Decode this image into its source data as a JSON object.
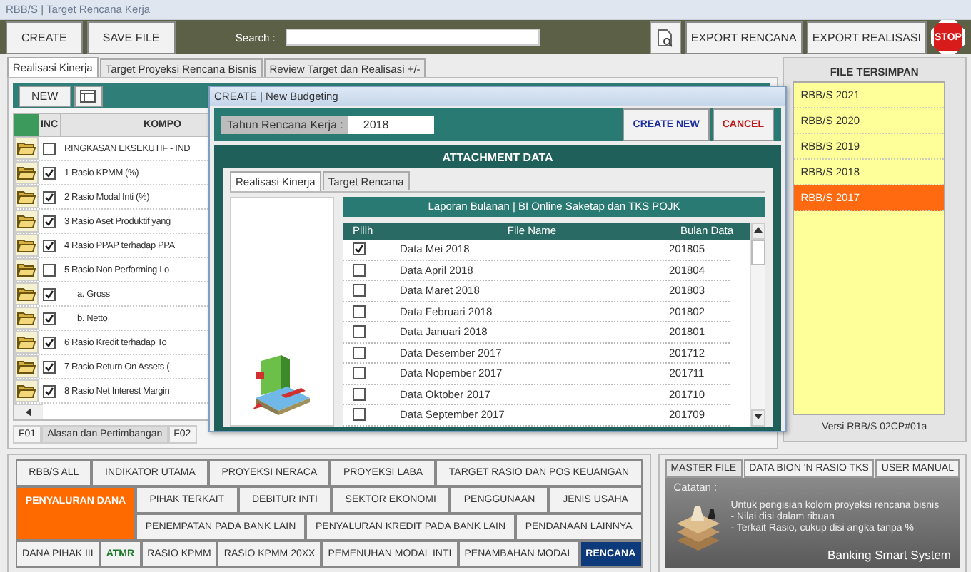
{
  "window": {
    "title": "RBB/S | Target Rencana Kerja"
  },
  "toolbar": {
    "buttons": [
      "CREATE",
      "SAVE FILE"
    ],
    "search_label": "Search :",
    "export_buttons": [
      "EXPORT RENCANA",
      "EXPORT REALISASI"
    ],
    "stop_label": "STOP"
  },
  "tabs": [
    {
      "label": "Realisasi Kinerja",
      "selected": true
    },
    {
      "label": "Target Proyeksi Rencana Bisnis",
      "selected": false
    },
    {
      "label": "Review Target dan Realisasi +/-",
      "selected": false
    }
  ],
  "panel": {
    "new_button": "NEW",
    "columns": [
      "INC",
      "KOMPO"
    ],
    "rows": [
      {
        "label": "RINGKASAN EKSEKUTIF - IND",
        "checked": false
      },
      {
        "label": "1 Rasio KPMM (%)",
        "checked": true
      },
      {
        "label": "2 Rasio Modal Inti (%)",
        "checked": true
      },
      {
        "label": "3 Rasio Aset Produktif yang",
        "checked": true
      },
      {
        "label": "4 Rasio PPAP terhadap PPA",
        "checked": true
      },
      {
        "label": "5 Rasio Non Performing Lo",
        "checked": false,
        "children": [
          {
            "label": "a. Gross",
            "checked": true
          },
          {
            "label": "b. Netto",
            "checked": true
          }
        ]
      },
      {
        "label": "6 Rasio Kredit terhadap To",
        "checked": true
      },
      {
        "label": "7 Rasio Return On Assets (",
        "checked": true
      },
      {
        "label": "8 Rasio Net Interest Margin",
        "checked": true
      }
    ],
    "bottom_tabs": [
      {
        "label": "F01",
        "selected": false
      },
      {
        "label": "Alasan dan Pertimbangan",
        "selected": true
      },
      {
        "label": "F02",
        "selected": false
      }
    ]
  },
  "files": {
    "title": "FILE TERSIMPAN",
    "items": [
      {
        "label": "RBB/S 2021",
        "selected": false
      },
      {
        "label": "RBB/S 2020",
        "selected": false
      },
      {
        "label": "RBB/S 2019",
        "selected": false
      },
      {
        "label": "RBB/S 2018",
        "selected": false
      },
      {
        "label": "RBB/S 2017",
        "selected": true
      }
    ],
    "version": "Versi RBB/S 02CP#01a"
  },
  "menu": {
    "row_1": [
      {
        "label": "RBB/S ALL",
        "kind": "normal",
        "selected": false
      },
      {
        "label": "INDIKATOR UTAMA",
        "kind": "normal",
        "selected": false
      },
      {
        "label": "PROYEKSI NERACA",
        "kind": "normal",
        "selected": false
      },
      {
        "label": "PROYEKSI LABA",
        "kind": "normal",
        "selected": false
      },
      {
        "label": "TARGET RASIO DAN POS KEUANGAN",
        "kind": "normal",
        "selected": false
      }
    ],
    "row_2_lead": {
      "label": "PENYALURAN DANA",
      "kind": "normal",
      "selected": true
    },
    "row_2": [
      {
        "label": "PIHAK TERKAIT",
        "kind": "normal",
        "selected": false
      },
      {
        "label": "DEBITUR INTI",
        "kind": "normal",
        "selected": false
      },
      {
        "label": "SEKTOR EKONOMI",
        "kind": "normal",
        "selected": false
      },
      {
        "label": "PENGGUNAAN",
        "kind": "normal",
        "selected": false
      },
      {
        "label": "JENIS USAHA",
        "kind": "normal",
        "selected": false
      }
    ],
    "row_3": [
      {
        "label": "PENEMPATAN PADA BANK LAIN",
        "kind": "normal",
        "selected": false
      },
      {
        "label": "PENYALURAN KREDIT PADA BANK LAIN",
        "kind": "normal",
        "selected": false
      },
      {
        "label": "PENDANAAN LAINNYA",
        "kind": "normal",
        "selected": false
      }
    ],
    "row_4": [
      {
        "label": "DANA PIHAK III",
        "kind": "normal",
        "selected": false
      },
      {
        "label": "ATMR",
        "kind": "accent",
        "selected": false
      },
      {
        "label": "RASIO KPMM",
        "kind": "normal",
        "selected": false
      },
      {
        "label": "RASIO KPMM 20XX",
        "kind": "normal",
        "selected": false
      },
      {
        "label": "PEMENUHAN MODAL INTI",
        "kind": "normal",
        "selected": false
      },
      {
        "label": "PENAMBAHAN MODAL",
        "kind": "normal",
        "selected": false
      },
      {
        "label": "RENCANA",
        "kind": "primary",
        "selected": false
      }
    ]
  },
  "side_tabs": [
    {
      "label": "MASTER FILE",
      "selected": true
    },
    {
      "label": "DATA BION 'N RASIO TKS",
      "selected": false
    },
    {
      "label": "USER MANUAL",
      "selected": false
    }
  ],
  "note": {
    "title": "Catatan :",
    "lines": [
      "Untuk pengisian kolom proyeksi rencana bisnis",
      "- Nilai disi dalam ribuan",
      "- Terkait Rasio, cukup disi angka tanpa %"
    ],
    "brand": "Banking Smart System"
  },
  "dialog": {
    "title": "CREATE | New Budgeting",
    "year_label": "Tahun Rencana Kerja :",
    "year": "2018",
    "buttons": [
      {
        "label": "CREATE NEW",
        "kind": "primary"
      },
      {
        "label": "CANCEL",
        "kind": "danger"
      }
    ],
    "section_title": "ATTACHMENT DATA",
    "tabs": [
      {
        "label": "Realisasi Kinerja",
        "selected": true
      },
      {
        "label": "Target Rencana",
        "selected": false
      }
    ],
    "list_title": "Laporan Bulanan | BI Online Saketap dan TKS POJK",
    "columns": [
      "Pilih",
      "File Name",
      "Bulan Data"
    ],
    "rows": [
      {
        "name": "Data Mei 2018",
        "month": "201805",
        "checked": true
      },
      {
        "name": "Data April 2018",
        "month": "201804",
        "checked": false
      },
      {
        "name": "Data Maret 2018",
        "month": "201803",
        "checked": false
      },
      {
        "name": "Data Februari 2018",
        "month": "201802",
        "checked": false
      },
      {
        "name": "Data Januari 2018",
        "month": "201801",
        "checked": false
      },
      {
        "name": "Data Desember 2017",
        "month": "201712",
        "checked": false
      },
      {
        "name": "Data Nopember 2017",
        "month": "201711",
        "checked": false
      },
      {
        "name": "Data Oktober 2017",
        "month": "201710",
        "checked": false
      },
      {
        "name": "Data September 2017",
        "month": "201709",
        "checked": false
      }
    ]
  }
}
